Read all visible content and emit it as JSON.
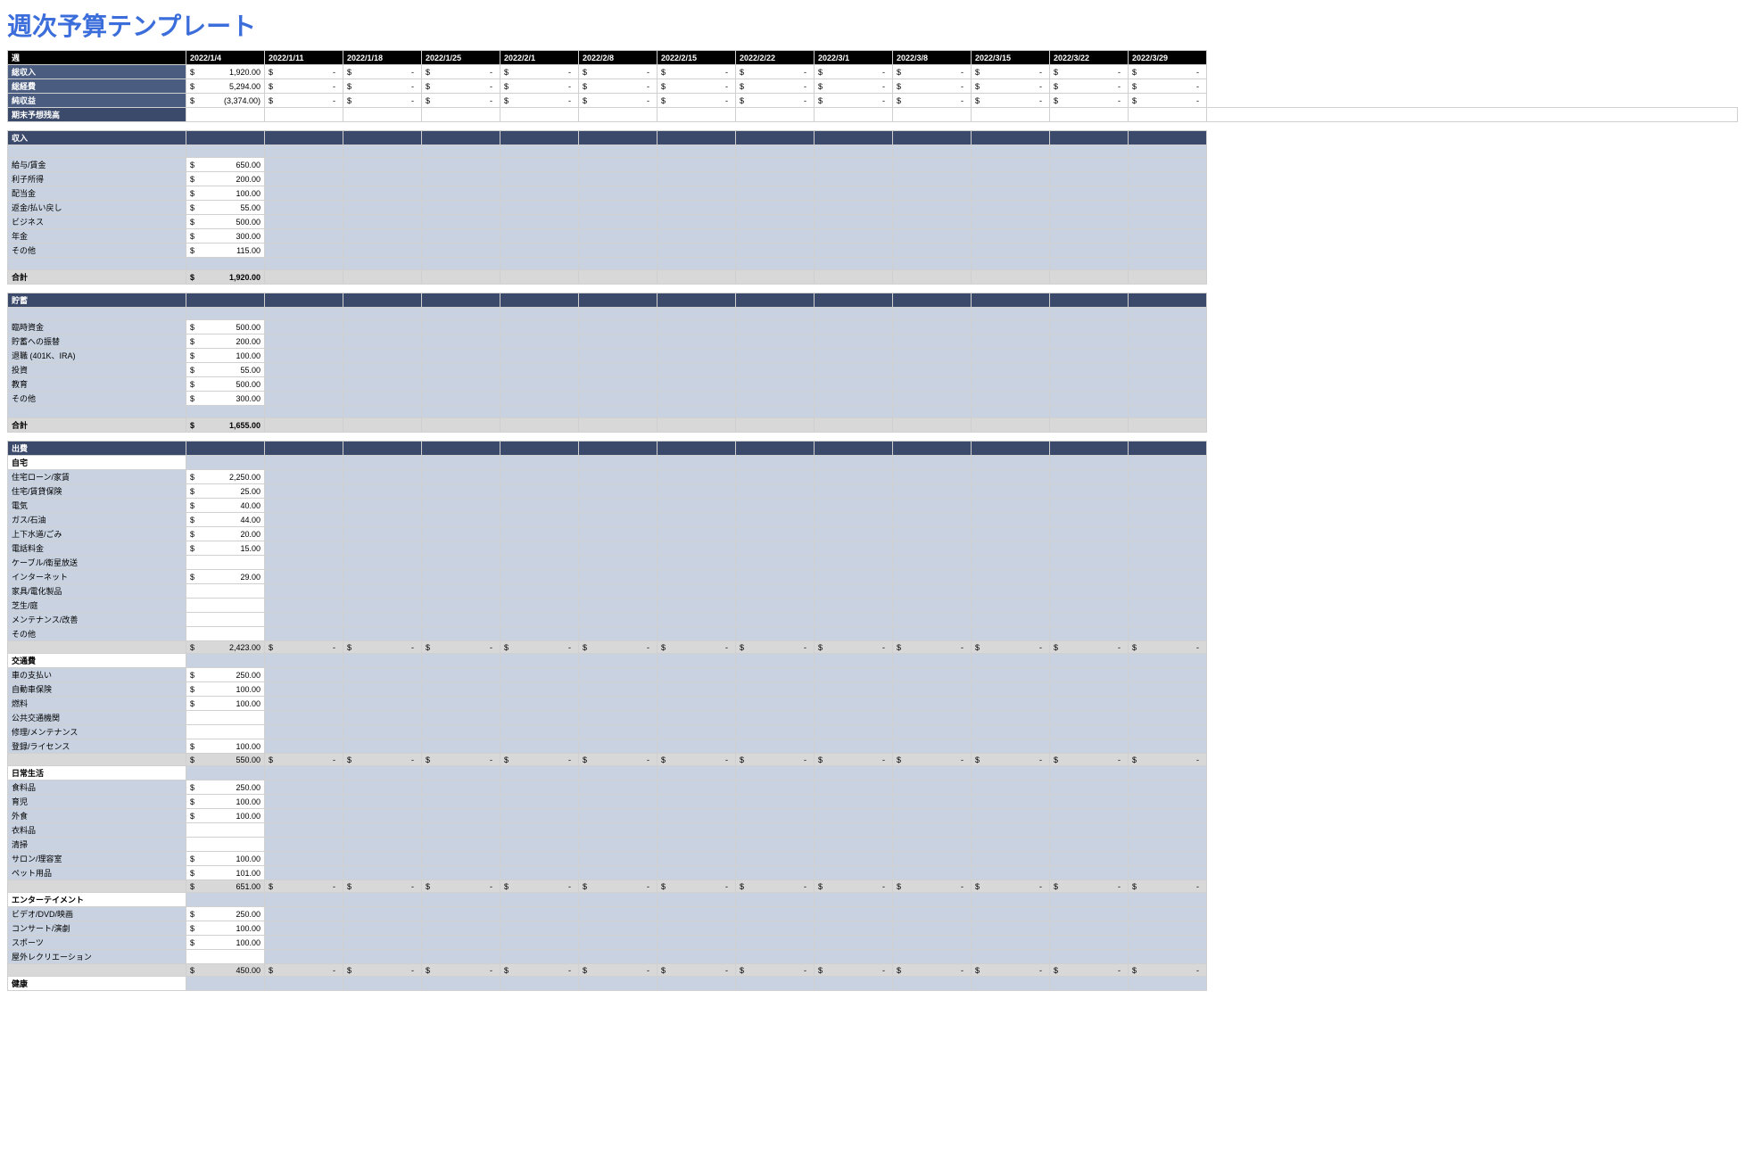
{
  "title": "週次予算テンプレート",
  "weeks": [
    "2022/1/4",
    "2022/1/11",
    "2022/1/18",
    "2022/1/25",
    "2022/2/1",
    "2022/2/8",
    "2022/2/15",
    "2022/2/22",
    "2022/3/1",
    "2022/3/8",
    "2022/3/15",
    "2022/3/22",
    "2022/3/29"
  ],
  "week_label": "週",
  "summary": [
    {
      "label": "総収入",
      "vals": [
        "1,920.00",
        "-",
        "-",
        "-",
        "-",
        "-",
        "-",
        "-",
        "-",
        "-",
        "-",
        "-",
        "-"
      ]
    },
    {
      "label": "総経費",
      "vals": [
        "5,294.00",
        "-",
        "-",
        "-",
        "-",
        "-",
        "-",
        "-",
        "-",
        "-",
        "-",
        "-",
        "-"
      ]
    },
    {
      "label": "純収益",
      "vals": [
        "(3,374.00)",
        "-",
        "-",
        "-",
        "-",
        "-",
        "-",
        "-",
        "-",
        "-",
        "-",
        "-",
        "-"
      ]
    },
    {
      "label": "期末予想残高",
      "vals": [
        "",
        "",
        "",
        "",
        "",
        "",
        "",
        "",
        "",
        "",
        "",
        "",
        "",
        ""
      ]
    }
  ],
  "sections": [
    {
      "title": "収入",
      "type": "single",
      "rows": [
        {
          "label": "給与/賃金",
          "val": "650.00"
        },
        {
          "label": "利子所得",
          "val": "200.00"
        },
        {
          "label": "配当金",
          "val": "100.00"
        },
        {
          "label": "返金/払い戻し",
          "val": "55.00"
        },
        {
          "label": "ビジネス",
          "val": "500.00"
        },
        {
          "label": "年金",
          "val": "300.00"
        },
        {
          "label": "その他",
          "val": "115.00"
        }
      ],
      "total": {
        "label": "合計",
        "val": "1,920.00"
      }
    },
    {
      "title": "貯蓄",
      "type": "single",
      "rows": [
        {
          "label": "臨時資金",
          "val": "500.00"
        },
        {
          "label": "貯蓄への振替",
          "val": "200.00"
        },
        {
          "label": "退職 (401K、IRA)",
          "val": "100.00"
        },
        {
          "label": "投資",
          "val": "55.00"
        },
        {
          "label": "教育",
          "val": "500.00"
        },
        {
          "label": "その他",
          "val": "300.00"
        }
      ],
      "total": {
        "label": "合計",
        "val": "1,655.00"
      }
    }
  ],
  "expense_title": "出費",
  "expense_groups": [
    {
      "title": "自宅",
      "rows": [
        {
          "label": "住宅ローン/家賃",
          "val": "2,250.00"
        },
        {
          "label": "住宅/賃貸保険",
          "val": "25.00"
        },
        {
          "label": "電気",
          "val": "40.00"
        },
        {
          "label": "ガス/石油",
          "val": "44.00"
        },
        {
          "label": "上下水道/ごみ",
          "val": "20.00"
        },
        {
          "label": "電話料金",
          "val": "15.00"
        },
        {
          "label": "ケーブル/衛星放送",
          "val": ""
        },
        {
          "label": "インターネット",
          "val": "29.00"
        },
        {
          "label": "家具/電化製品",
          "val": ""
        },
        {
          "label": "芝生/庭",
          "val": ""
        },
        {
          "label": "メンテナンス/改善",
          "val": ""
        },
        {
          "label": "その他",
          "val": ""
        }
      ],
      "subtotal": "2,423.00"
    },
    {
      "title": "交通費",
      "rows": [
        {
          "label": "車の支払い",
          "val": "250.00"
        },
        {
          "label": "自動車保険",
          "val": "100.00"
        },
        {
          "label": "燃料",
          "val": "100.00"
        },
        {
          "label": "公共交通機関",
          "val": ""
        },
        {
          "label": "修理/メンテナンス",
          "val": ""
        },
        {
          "label": "登録/ライセンス",
          "val": "100.00"
        }
      ],
      "subtotal": "550.00"
    },
    {
      "title": "日常生活",
      "rows": [
        {
          "label": "食料品",
          "val": "250.00"
        },
        {
          "label": "育児",
          "val": "100.00"
        },
        {
          "label": "外食",
          "val": "100.00"
        },
        {
          "label": "衣料品",
          "val": ""
        },
        {
          "label": "清掃",
          "val": ""
        },
        {
          "label": "サロン/理容室",
          "val": "100.00"
        },
        {
          "label": "ペット用品",
          "val": "101.00"
        }
      ],
      "subtotal": "651.00"
    },
    {
      "title": "エンターテイメント",
      "rows": [
        {
          "label": "ビデオ/DVD/映画",
          "val": "250.00"
        },
        {
          "label": "コンサート/演劇",
          "val": "100.00"
        },
        {
          "label": "スポーツ",
          "val": "100.00"
        },
        {
          "label": "屋外レクリエーション",
          "val": ""
        }
      ],
      "subtotal": "450.00"
    },
    {
      "title": "健康",
      "rows": []
    }
  ]
}
